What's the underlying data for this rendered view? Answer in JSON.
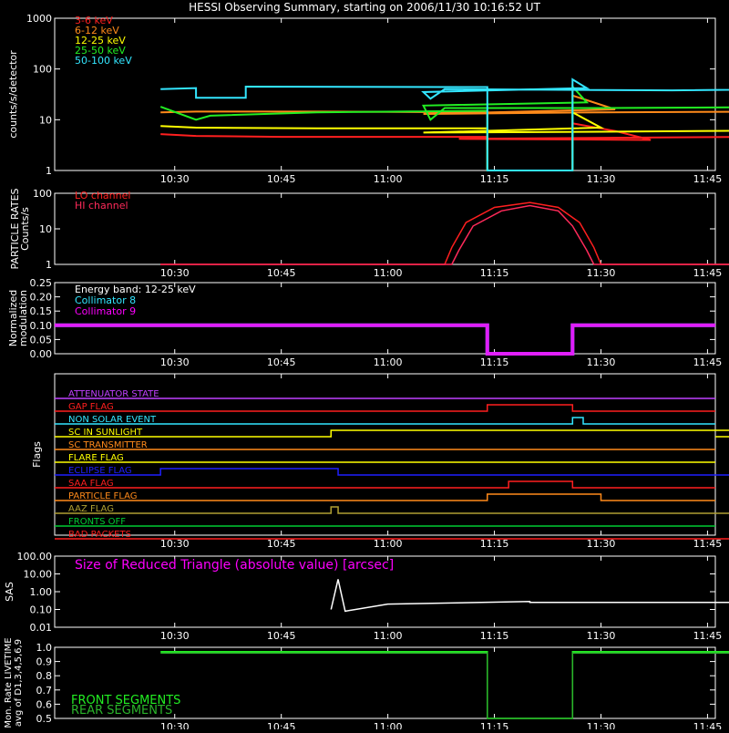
{
  "title": "HESSI Observing Summary, starting on 2006/11/30 10:16:52 UT",
  "x_tick_labels": [
    "10:30",
    "10:45",
    "11:00",
    "11:15",
    "11:30",
    "11:45"
  ],
  "colors": {
    "white": "#ffffff",
    "red": "#ff1f1f",
    "orange": "#ff8a1a",
    "yellow": "#ffff00",
    "green": "#22ee22",
    "cyan": "#33e6ff",
    "magenta": "#ff00ff",
    "crimson": "#ff2a5a",
    "blue": "#1f1fff",
    "olive": "#b0a032",
    "purple": "#c040ff",
    "flag_green": "#00cc33",
    "live_green": "#2bb52b"
  },
  "chart_data": [
    {
      "type": "line",
      "id": "count-rates",
      "ylabel": "counts/s/detector",
      "yscale": "log",
      "ylim": [
        1,
        1000
      ],
      "ytick_labels": [
        "1",
        "10",
        "100",
        "1000"
      ],
      "x_unit": "minutes",
      "xlim": [
        10.28,
        11.82
      ],
      "series": [
        {
          "name": "3-6 keV",
          "color": "red",
          "points": [
            [
              10.28,
              5.2
            ],
            [
              10.33,
              4.8
            ],
            [
              10.45,
              4.6
            ],
            [
              10.74,
              4.6
            ],
            [
              10.74,
              1
            ],
            [
              10.86,
              1
            ],
            [
              10.86,
              8.5
            ],
            [
              10.92,
              6.0
            ],
            [
              10.97,
              4.0
            ],
            [
              11.1,
              4.2
            ],
            [
              11.5,
              4.6
            ],
            [
              11.82,
              5.2
            ]
          ]
        },
        {
          "name": "6-12 keV",
          "color": "orange",
          "points": [
            [
              10.28,
              14
            ],
            [
              10.33,
              14.5
            ],
            [
              10.5,
              14.5
            ],
            [
              10.74,
              14
            ],
            [
              10.74,
              1
            ],
            [
              10.86,
              1
            ],
            [
              10.86,
              30
            ],
            [
              10.92,
              16
            ],
            [
              11.05,
              13
            ],
            [
              11.3,
              14
            ],
            [
              11.82,
              15
            ]
          ]
        },
        {
          "name": "12-25 keV",
          "color": "yellow",
          "points": [
            [
              10.28,
              7.5
            ],
            [
              10.33,
              7.0
            ],
            [
              10.5,
              6.8
            ],
            [
              10.74,
              6.8
            ],
            [
              10.74,
              1
            ],
            [
              10.86,
              1
            ],
            [
              10.86,
              14
            ],
            [
              10.9,
              7
            ],
            [
              11.05,
              5.6
            ],
            [
              11.3,
              5.8
            ],
            [
              11.82,
              6.5
            ]
          ]
        },
        {
          "name": "25-50 keV",
          "color": "green",
          "points": [
            [
              10.28,
              18
            ],
            [
              10.33,
              10
            ],
            [
              10.35,
              12
            ],
            [
              10.5,
              14
            ],
            [
              10.74,
              15
            ],
            [
              10.74,
              1
            ],
            [
              10.86,
              1
            ],
            [
              10.86,
              45
            ],
            [
              10.88,
              22
            ],
            [
              11.05,
              19
            ],
            [
              11.06,
              10
            ],
            [
              11.08,
              17
            ],
            [
              11.3,
              17
            ],
            [
              11.82,
              18.5
            ]
          ]
        },
        {
          "name": "50-100 keV",
          "color": "cyan",
          "points": [
            [
              10.28,
              40
            ],
            [
              10.33,
              42
            ],
            [
              10.33,
              27
            ],
            [
              10.4,
              27
            ],
            [
              10.4,
              45
            ],
            [
              10.74,
              44
            ],
            [
              10.74,
              1
            ],
            [
              10.86,
              1
            ],
            [
              10.86,
              62
            ],
            [
              10.88,
              42
            ],
            [
              11.05,
              35
            ],
            [
              11.06,
              26
            ],
            [
              11.08,
              40
            ],
            [
              11.4,
              38
            ],
            [
              11.82,
              43
            ]
          ]
        }
      ]
    },
    {
      "type": "line",
      "id": "particle-rates",
      "ylabel": "PARTICLE RATES Counts/s",
      "yscale": "log",
      "ylim": [
        1,
        100
      ],
      "ytick_labels": [
        "1",
        "10",
        "100"
      ],
      "xlim": [
        10.28,
        11.82
      ],
      "series": [
        {
          "name": "LO channel",
          "color": "red",
          "points": [
            [
              10.28,
              1
            ],
            [
              10.68,
              1
            ],
            [
              10.69,
              3
            ],
            [
              10.71,
              15
            ],
            [
              10.75,
              40
            ],
            [
              10.8,
              55
            ],
            [
              10.84,
              40
            ],
            [
              10.87,
              15
            ],
            [
              10.89,
              3
            ],
            [
              10.9,
              1
            ],
            [
              11.82,
              1
            ]
          ]
        },
        {
          "name": "HI channel",
          "color": "crimson",
          "points": [
            [
              10.28,
              1
            ],
            [
              10.69,
              1
            ],
            [
              10.7,
              2.5
            ],
            [
              10.72,
              12
            ],
            [
              10.76,
              32
            ],
            [
              10.8,
              45
            ],
            [
              10.84,
              32
            ],
            [
              10.86,
              12
            ],
            [
              10.88,
              2.5
            ],
            [
              10.89,
              1
            ],
            [
              11.82,
              1
            ]
          ]
        }
      ]
    },
    {
      "type": "line",
      "id": "modulation",
      "ylabel": "Normalized modulation",
      "ylim": [
        0.0,
        0.25
      ],
      "ytick_labels": [
        "0.00",
        "0.05",
        "0.10",
        "0.15",
        "0.20",
        "0.25"
      ],
      "xlim": [
        10.28,
        11.82
      ],
      "annotation": "Energy band: 12-25 keV",
      "series": [
        {
          "name": "Collimator 8",
          "color": "cyan",
          "level": 0.1
        },
        {
          "name": "Collimator 9",
          "color": "magenta",
          "level": 0.1
        }
      ],
      "gap": [
        10.74,
        10.86
      ]
    },
    {
      "type": "line",
      "id": "flags",
      "ylabel": "Flags",
      "xlim": [
        10.28,
        11.82
      ],
      "flags": [
        {
          "name": "ATTENUATOR STATE",
          "color": "purple",
          "segments": []
        },
        {
          "name": "GAP FLAG",
          "color": "red",
          "segments": [
            [
              10.74,
              10.86
            ]
          ]
        },
        {
          "name": "NON SOLAR EVENT",
          "color": "cyan",
          "segments": [
            [
              10.86,
              10.875
            ]
          ]
        },
        {
          "name": "SC IN SUNLIGHT",
          "color": "yellow",
          "segments": [
            [
              10.52,
              11.52
            ]
          ]
        },
        {
          "name": "SC TRANSMITTER",
          "color": "orange",
          "segments": []
        },
        {
          "name": "FLARE FLAG",
          "color": "yellow",
          "segments": []
        },
        {
          "name": "ECLIPSE FLAG",
          "color": "blue",
          "segments": [
            [
              10.28,
              10.53
            ],
            [
              11.52,
              11.82
            ]
          ]
        },
        {
          "name": "SAA FLAG",
          "color": "red",
          "segments": [
            [
              10.77,
              10.86
            ]
          ]
        },
        {
          "name": "PARTICLE FLAG",
          "color": "orange",
          "segments": [
            [
              10.74,
              10.9
            ]
          ]
        },
        {
          "name": "AAZ FLAG",
          "color": "olive",
          "segments": [
            [
              10.52,
              10.53
            ],
            [
              11.52,
              11.53
            ]
          ]
        },
        {
          "name": "FRONTS OFF",
          "color": "flag_green",
          "segments": []
        },
        {
          "name": "BAD PACKETS",
          "color": "red",
          "segments": [
            [
              11.75,
              11.752
            ],
            [
              11.81,
              11.812
            ]
          ]
        }
      ]
    },
    {
      "type": "line",
      "id": "sas",
      "ylabel": "SAS",
      "yscale": "log",
      "ylim": [
        0.01,
        100
      ],
      "ytick_labels": [
        "0.01",
        "0.10",
        "1.00",
        "10.00",
        "100.00"
      ],
      "xlim": [
        10.28,
        11.82
      ],
      "annotation": "Size of Reduced Triangle (absolute value) [arcsec]",
      "series": [
        {
          "name": "",
          "color": "white",
          "points": [
            [
              10.52,
              0.1
            ],
            [
              10.53,
              5
            ],
            [
              10.54,
              0.08
            ],
            [
              10.6,
              0.2
            ],
            [
              10.8,
              0.28
            ],
            [
              11.2,
              0.25
            ],
            [
              11.5,
              0.25
            ],
            [
              11.51,
              10
            ],
            [
              11.52,
              0.05
            ]
          ]
        }
      ]
    },
    {
      "type": "line",
      "id": "livetime",
      "ylabel": "Mon. Rate LIVETIME avg of D1,3,4,5,6,9",
      "ylim": [
        0.5,
        1.0
      ],
      "ytick_labels": [
        "0.5",
        "0.6",
        "0.7",
        "0.8",
        "0.9",
        "1.0"
      ],
      "xlim": [
        10.28,
        11.82
      ],
      "series": [
        {
          "name": "FRONT SEGMENTS",
          "color": "green",
          "points": [
            [
              10.28,
              0.97
            ],
            [
              10.74,
              0.97
            ],
            [
              10.74,
              0.5
            ],
            [
              10.86,
              0.5
            ],
            [
              10.86,
              0.97
            ],
            [
              11.82,
              0.97
            ]
          ]
        },
        {
          "name": "REAR SEGMENTS",
          "color": "live_green",
          "points": [
            [
              10.28,
              0.96
            ],
            [
              10.74,
              0.96
            ],
            [
              10.74,
              0.5
            ],
            [
              10.86,
              0.5
            ],
            [
              10.86,
              0.96
            ],
            [
              11.82,
              0.96
            ]
          ]
        }
      ]
    }
  ]
}
